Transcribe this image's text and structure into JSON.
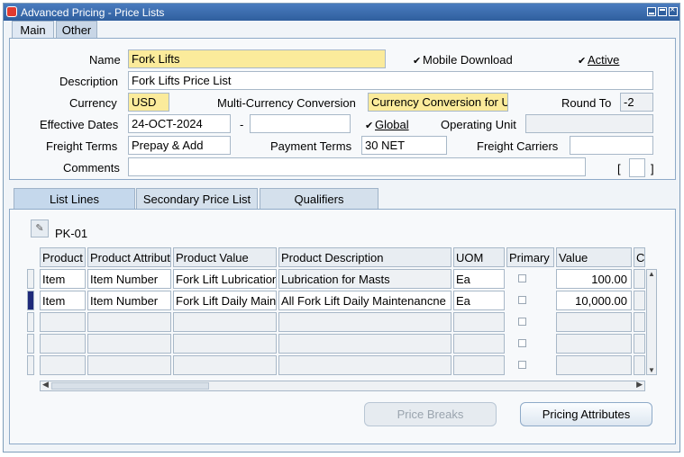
{
  "window": {
    "title": "Advanced Pricing - Price Lists"
  },
  "tabs": [
    {
      "label": "Main"
    },
    {
      "label": "Other"
    }
  ],
  "header": {
    "name_label": "Name",
    "name_value": "Fork Lifts",
    "mobile_download_label": "Mobile Download",
    "mobile_download_checked": true,
    "active_label": "Active",
    "active_checked": true,
    "description_label": "Description",
    "description_value": "Fork Lifts Price List",
    "currency_label": "Currency",
    "currency_value": "USD",
    "multi_currency_label": "Multi-Currency Conversion",
    "multi_currency_value": "Currency Conversion for U",
    "round_to_label": "Round To",
    "round_to_value": "-2",
    "effective_dates_label": "Effective Dates",
    "effective_from": "24-OCT-2024",
    "effective_dash": "-",
    "effective_to": "",
    "global_label": "Global",
    "global_checked": true,
    "operating_unit_label": "Operating Unit",
    "operating_unit_value": "",
    "freight_terms_label": "Freight Terms",
    "freight_terms_value": "Prepay & Add",
    "payment_terms_label": "Payment Terms",
    "payment_terms_value": "30 NET",
    "freight_carriers_label": "Freight Carriers",
    "freight_carriers_value": "",
    "comments_label": "Comments",
    "comments_value": "",
    "bracket_open": "[",
    "bracket_close": "]"
  },
  "lines_tabs": [
    {
      "label": "List Lines"
    },
    {
      "label": "Secondary Price List"
    },
    {
      "label": "Qualifiers"
    }
  ],
  "folder": {
    "name": "PK-01"
  },
  "columns": [
    {
      "label": "Product"
    },
    {
      "label": "Product Attribut"
    },
    {
      "label": "Product Value"
    },
    {
      "label": "Product Description"
    },
    {
      "label": "UOM"
    },
    {
      "label": "Primary"
    },
    {
      "label": "Value"
    },
    {
      "label": "C"
    }
  ],
  "rows": [
    {
      "product": "Item",
      "attribute": "Item Number",
      "value": "Fork Lift Lubrication",
      "description": "Lubrication for Masts",
      "uom": "Ea",
      "primary": false,
      "price": "100.00"
    },
    {
      "product": "Item",
      "attribute": "Item Number",
      "value": "Fork Lift Daily Main",
      "description": "All Fork Lift Daily Maintenancne",
      "uom": "Ea",
      "primary": false,
      "price": "10,000.00"
    }
  ],
  "buttons": {
    "price_breaks": "Price Breaks",
    "pricing_attributes": "Pricing Attributes"
  }
}
